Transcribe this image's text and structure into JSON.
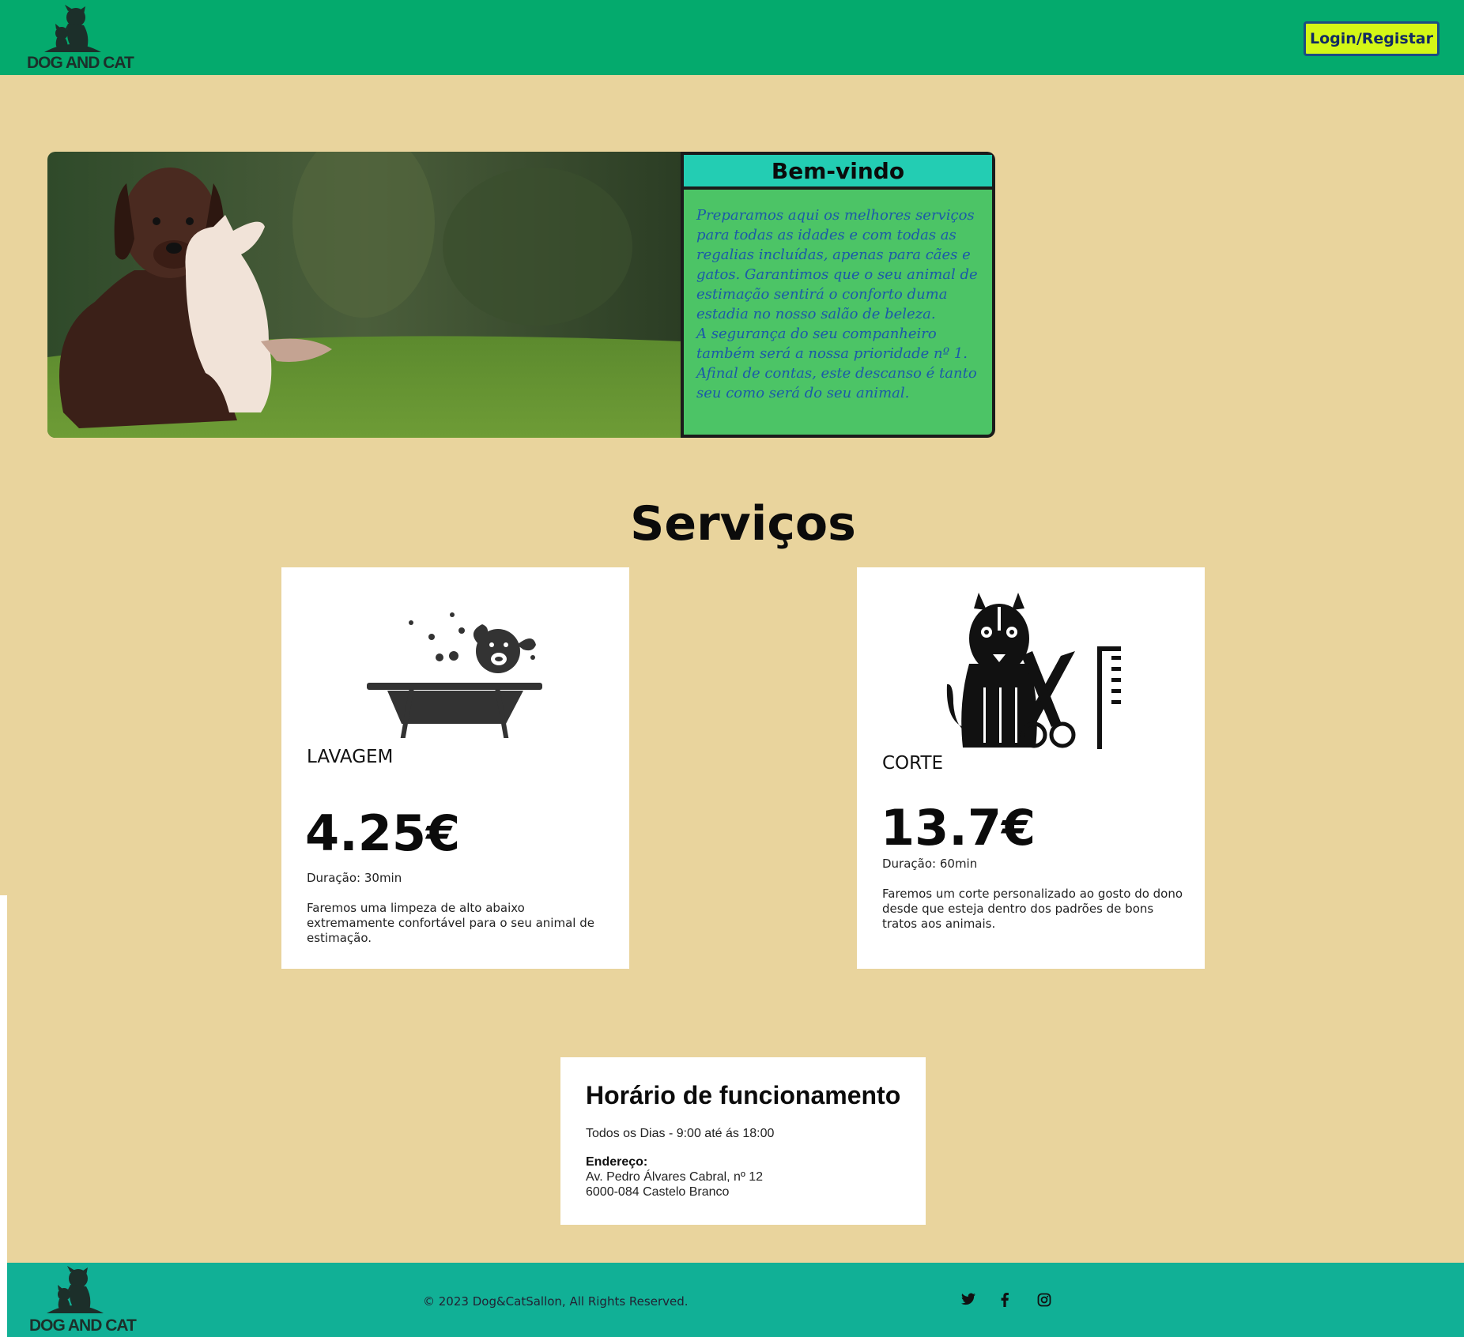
{
  "brand": {
    "logo_text": "DOG AND CAT"
  },
  "header": {
    "login_label": "Login/Registar"
  },
  "hero": {
    "welcome_title": "Bem-vindo",
    "welcome_text": "Preparamos aqui os melhores serviços para todas as idades e com todas as regalias incluídas, apenas para cães e gatos. Garantimos que o seu animal de estimação sentirá o conforto duma estadia no nosso salão de beleza.\nA segurança do seu companheiro também será a nossa prioridade nº 1. Afinal de contas, este descanso é tanto seu como será do seu animal."
  },
  "services": {
    "title": "Serviços",
    "items": [
      {
        "name": "LAVAGEM",
        "price": "4.25€",
        "duration": "Duração: 30min",
        "description": "Faremos uma limpeza de alto abaixo extremamente confortável para o seu animal de estimação.",
        "icon": "dog-bath-icon"
      },
      {
        "name": "CORTE",
        "price": "13.7€",
        "duration": "Duração: 60min",
        "description": "Faremos um corte personalizado ao gosto do dono desde que esteja dentro dos padrões de bons tratos aos animais.",
        "icon": "dog-grooming-icon"
      }
    ]
  },
  "hours": {
    "title": "Horário de funcionamento",
    "schedule": "Todos os Dias - 9:00 até ás 18:00",
    "address_label": "Endereço:",
    "address_line1": "Av. Pedro Álvares Cabral, nº 12",
    "address_line2": "6000-084 Castelo Branco"
  },
  "footer": {
    "copyright": "© 2023 Dog&CatSallon, All Rights Reserved.",
    "social": [
      "twitter-icon",
      "facebook-icon",
      "instagram-icon"
    ]
  },
  "colors": {
    "background": "#e9d49d",
    "header": "#04aa6d",
    "footer": "#11b096",
    "login_button": "#d4f716",
    "welcome_panel": "#4cc466",
    "welcome_title_bar": "#23cdb3",
    "welcome_text": "#1b5aa8"
  }
}
